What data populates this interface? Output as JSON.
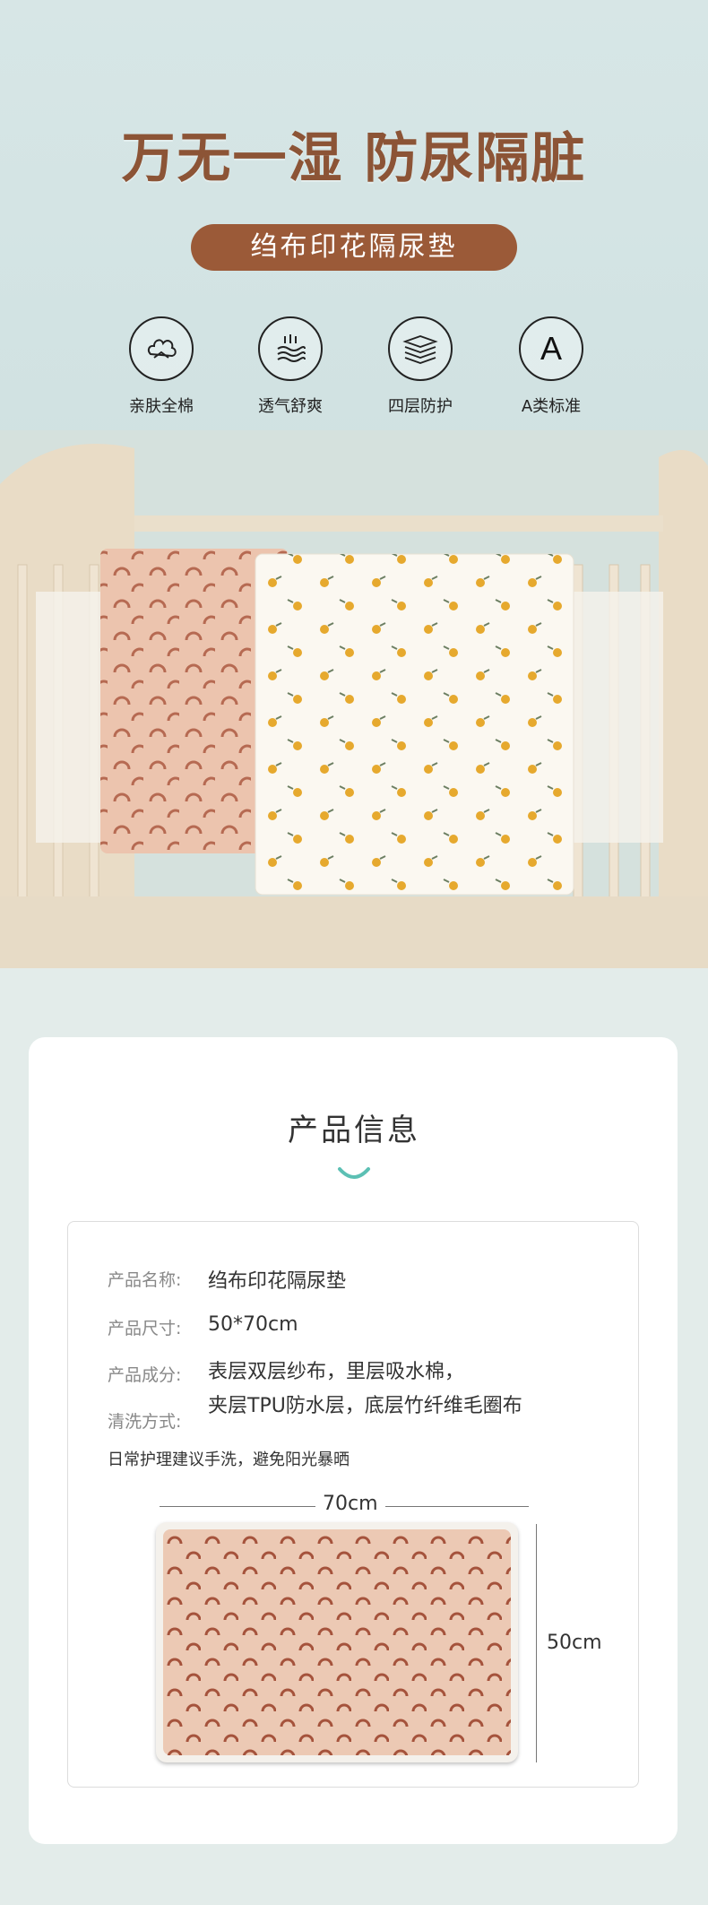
{
  "hero": {
    "headline": "万无一湿 防尿隔脏",
    "pill": "绉布印花隔尿垫",
    "features": [
      {
        "icon": "cotton-icon",
        "label": "亲肤全棉"
      },
      {
        "icon": "breathable-waves-icon",
        "label": "透气舒爽"
      },
      {
        "icon": "layers-icon",
        "label": "四层防护"
      },
      {
        "icon": "grade-a-icon",
        "label": "A类标准",
        "glyph": "A"
      }
    ],
    "colors": {
      "headline": "#8c5436",
      "pill": "#9b5a38",
      "background": "#d7e6e6"
    }
  },
  "info": {
    "title": "产品信息",
    "rows": [
      {
        "label": "产品名称:",
        "value": "绉布印花隔尿垫"
      },
      {
        "label": "产品尺寸:",
        "value": "50*70cm"
      },
      {
        "label": "产品成分:",
        "value": "表层双层纱布，里层吸水棉，"
      },
      {
        "label": "清洗方式:",
        "value": "夹层TPU防水层，底层竹纤维毛圈布"
      }
    ],
    "care": "日常护理建议手洗，避免阳光暴晒",
    "width_label": "70cm",
    "height_label": "50cm"
  }
}
